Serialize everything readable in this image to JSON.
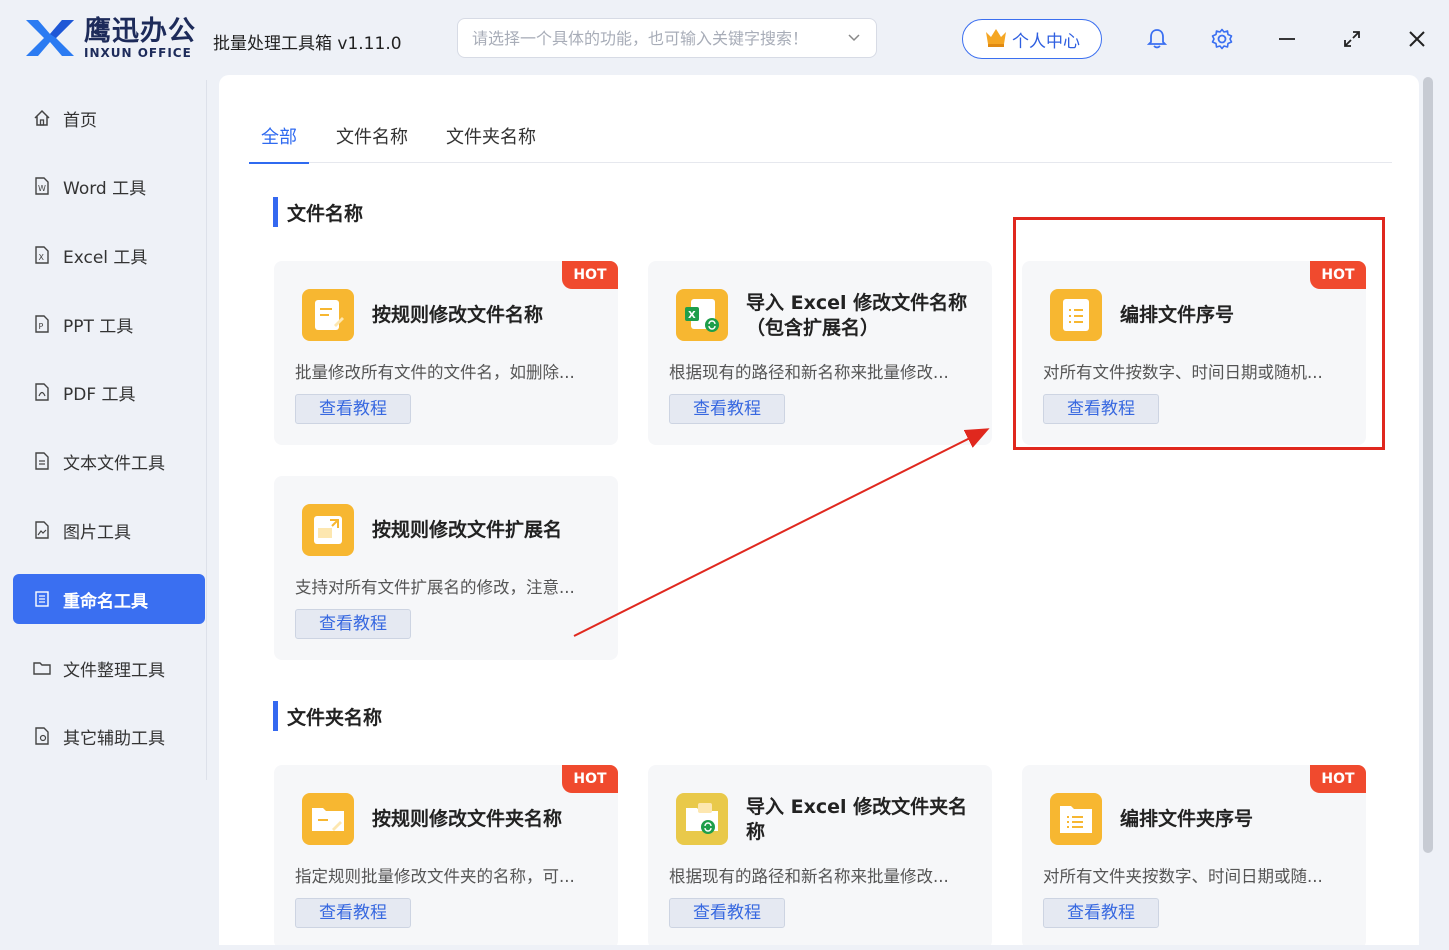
{
  "app": {
    "brand_cn": "鹰迅办公",
    "brand_en": "INXUN OFFICE",
    "title": "批量处理工具箱 v1.11.0",
    "search_placeholder": "请选择一个具体的功能，也可输入关键字搜索！",
    "user_center": "个人中心"
  },
  "sidebar": {
    "items": [
      {
        "label": "首页",
        "icon": "home-icon"
      },
      {
        "label": "Word 工具",
        "icon": "word-file-icon"
      },
      {
        "label": "Excel 工具",
        "icon": "excel-file-icon"
      },
      {
        "label": "PPT 工具",
        "icon": "ppt-file-icon"
      },
      {
        "label": "PDF 工具",
        "icon": "pdf-file-icon"
      },
      {
        "label": "文本文件工具",
        "icon": "text-file-icon"
      },
      {
        "label": "图片工具",
        "icon": "image-file-icon"
      },
      {
        "label": "重命名工具",
        "icon": "rename-icon",
        "active": true
      },
      {
        "label": "文件整理工具",
        "icon": "folder-icon"
      },
      {
        "label": "其它辅助工具",
        "icon": "tools-icon"
      }
    ]
  },
  "tabs": [
    {
      "label": "全部",
      "active": true
    },
    {
      "label": "文件名称"
    },
    {
      "label": "文件夹名称"
    }
  ],
  "sections": [
    {
      "title": "文件名称",
      "cards": [
        {
          "title": "按规则修改文件名称",
          "desc": "批量修改所有文件的文件名，如删除...",
          "button": "查看教程",
          "hot": "HOT",
          "icon": "doc-edit-icon"
        },
        {
          "title": "导入 Excel 修改文件名称（包含扩展名）",
          "desc": "根据现有的路径和新名称来批量修改...",
          "button": "查看教程",
          "icon": "excel-import-icon"
        },
        {
          "title": "编排文件序号",
          "desc": "对所有文件按数字、时间日期或随机...",
          "button": "查看教程",
          "hot": "HOT",
          "icon": "doc-list-icon"
        },
        {
          "title": "按规则修改文件扩展名",
          "desc": "支持对所有文件扩展名的修改，注意...",
          "button": "查看教程",
          "icon": "extension-icon"
        }
      ]
    },
    {
      "title": "文件夹名称",
      "cards": [
        {
          "title": "按规则修改文件夹名称",
          "desc": "指定规则批量修改文件夹的名称，可...",
          "button": "查看教程",
          "hot": "HOT",
          "icon": "folder-edit-icon"
        },
        {
          "title": "导入 Excel 修改文件夹名称",
          "desc": "根据现有的路径和新名称来批量修改...",
          "button": "查看教程",
          "icon": "folder-excel-icon"
        },
        {
          "title": "编排文件夹序号",
          "desc": "对所有文件夹按数字、时间日期或随...",
          "button": "查看教程",
          "hot": "HOT",
          "icon": "folder-list-icon"
        }
      ]
    }
  ],
  "colors": {
    "accent": "#3a6ff1",
    "hot": "#f04a2e",
    "icon_orange": "#f7b731",
    "highlight": "#e0281e"
  }
}
